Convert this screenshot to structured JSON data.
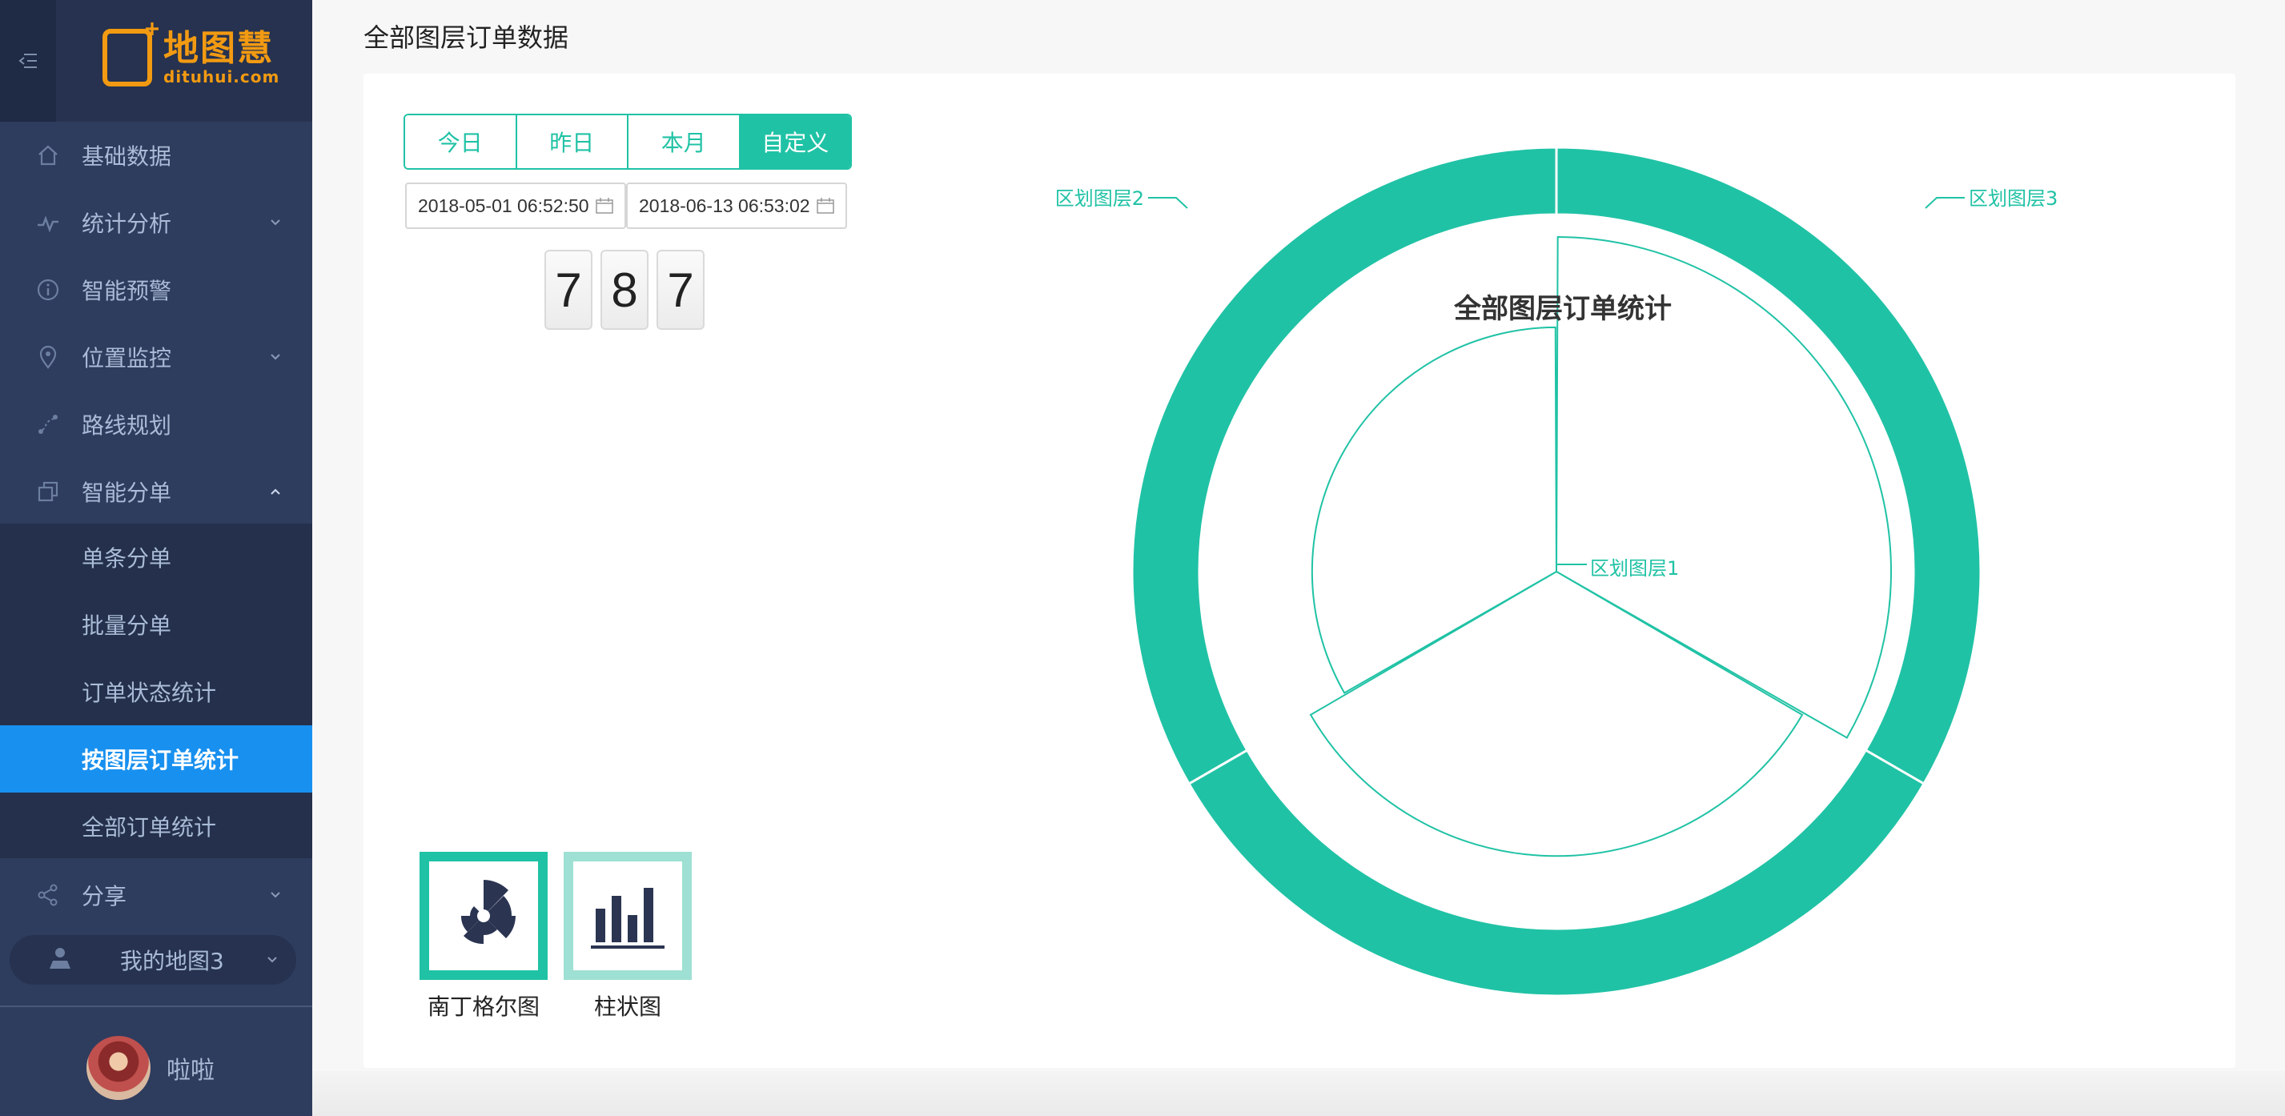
{
  "brand": {
    "name_cn": "地图慧",
    "domain": "dituhui.com"
  },
  "colors": {
    "accent": "#20c2a5",
    "active_menu": "#1890ef",
    "sidebar_bg": "#2e3c5e",
    "logo": "#f29a12"
  },
  "sidebar": {
    "items": [
      {
        "label": "基础数据",
        "icon": "home-icon",
        "arrow": ""
      },
      {
        "label": "统计分析",
        "icon": "stats-line-icon",
        "arrow": "down"
      },
      {
        "label": "智能预警",
        "icon": "info-icon",
        "arrow": ""
      },
      {
        "label": "位置监控",
        "icon": "location-pin-icon",
        "arrow": "down"
      },
      {
        "label": "路线规划",
        "icon": "route-icon",
        "arrow": ""
      },
      {
        "label": "智能分单",
        "icon": "layers-icon",
        "arrow": "up"
      }
    ],
    "submenu": [
      {
        "label": "单条分单",
        "active": false
      },
      {
        "label": "批量分单",
        "active": false
      },
      {
        "label": "订单状态统计",
        "active": false
      },
      {
        "label": "按图层订单统计",
        "active": true
      },
      {
        "label": "全部订单统计",
        "active": false
      }
    ],
    "share": {
      "label": "分享",
      "icon": "share-icon"
    },
    "my_map": {
      "label": "我的地图3",
      "icon": "user-map-icon"
    },
    "user": {
      "name": "啦啦"
    }
  },
  "page": {
    "title": "全部图层订单数据"
  },
  "filters": {
    "ranges": [
      "今日",
      "昨日",
      "本月",
      "自定义"
    ],
    "active_range": "自定义",
    "start_date": "2018-05-01 06:52:50",
    "end_date": "2018-06-13 06:53:02"
  },
  "counter": {
    "value": "787",
    "digits": [
      "7",
      "8",
      "7"
    ]
  },
  "chart_types": [
    {
      "label": "南丁格尔图",
      "icon": "nightingale-chart-icon",
      "selected": true
    },
    {
      "label": "柱状图",
      "icon": "bar-chart-icon",
      "selected": false
    }
  ],
  "chart_data": {
    "type": "pie",
    "title": "全部图层订单统计",
    "categories": [
      "区划图层3",
      "区划图层1",
      "区划图层2"
    ],
    "outer_ring_values": [
      1,
      1,
      1
    ],
    "inner_rose_values": [
      1,
      0.85,
      0.73
    ],
    "legend": "none",
    "colors": [
      "#20c2a5"
    ]
  }
}
